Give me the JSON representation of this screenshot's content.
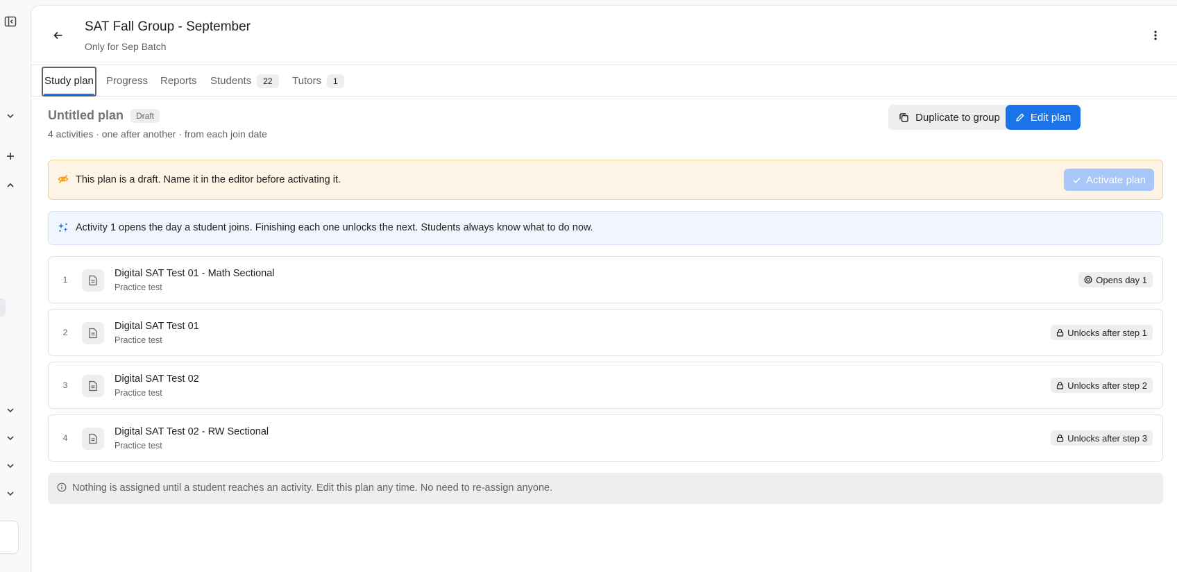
{
  "header": {
    "title": "SAT Fall Group - September",
    "subtitle": "Only for Sep Batch"
  },
  "tabs": [
    {
      "label": "Study plan",
      "active": true,
      "count": ""
    },
    {
      "label": "Progress",
      "active": false,
      "count": ""
    },
    {
      "label": "Reports",
      "active": false,
      "count": ""
    },
    {
      "label": "Students",
      "active": false,
      "count": "22"
    },
    {
      "label": "Tutors",
      "active": false,
      "count": "1"
    }
  ],
  "plan": {
    "title": "Untitled plan",
    "badge": "Draft",
    "meta": "4 activities · one after another · from each join date",
    "duplicate_label": "Duplicate to group",
    "edit_label": "Edit plan"
  },
  "draft_banner": {
    "text": "This plan is a draft. Name it in the editor before activating it.",
    "activate_label": "Activate plan"
  },
  "info_banner": {
    "text": "Activity 1 opens the day a student joins. Finishing each one unlocks the next. Students always know what to do now."
  },
  "activities": [
    {
      "num": "1",
      "name": "Digital SAT Test 01 - Math Sectional",
      "type": "Practice test",
      "status": "Opens day 1",
      "status_icon": "target-icon"
    },
    {
      "num": "2",
      "name": "Digital SAT Test 01",
      "type": "Practice test",
      "status": "Unlocks after step 1",
      "status_icon": "lock-icon"
    },
    {
      "num": "3",
      "name": "Digital SAT Test 02",
      "type": "Practice test",
      "status": "Unlocks after step 2",
      "status_icon": "lock-icon"
    },
    {
      "num": "4",
      "name": "Digital SAT Test 02 - RW Sectional",
      "type": "Practice test",
      "status": "Unlocks after step 3",
      "status_icon": "lock-icon"
    }
  ],
  "footer_note": {
    "text": "Nothing is assigned until a student reaches an activity. Edit this plan any time. No need to re-assign anyone."
  },
  "colors": {
    "accent": "#1a73e8",
    "draft_banner_bg": "#fef4e5",
    "draft_icon": "#f29900",
    "info_icon": "#1a73e8"
  }
}
